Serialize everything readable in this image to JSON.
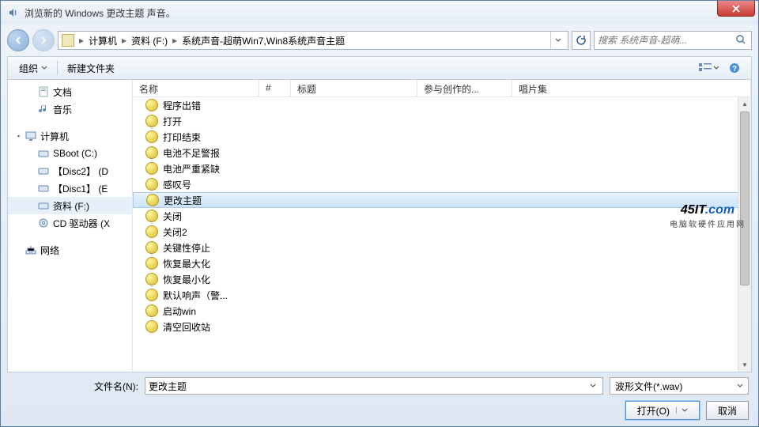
{
  "titlebar": {
    "title": "浏览新的 Windows 更改主题 声音。",
    "close": "X"
  },
  "breadcrumb": {
    "segments": [
      "计算机",
      "资料 (F:)",
      "系统声音-超萌Win7,Win8系统声音主题"
    ],
    "sep": "▸"
  },
  "search": {
    "placeholder": "搜索 系统声音-超萌..."
  },
  "toolbar": {
    "organize": "组织",
    "newfolder": "新建文件夹"
  },
  "tree": {
    "docs": "文档",
    "music": "音乐",
    "computer": "计算机",
    "sboot": "SBoot (C:)",
    "disc2": "【Disc2】 (D",
    "disc1": "【Disc1】 (E",
    "ziliao": "资料 (F:)",
    "cd": "CD 驱动器 (X",
    "network": "网络"
  },
  "columns": {
    "name": "名称",
    "num": "#",
    "title": "标题",
    "artists": "参与创作的...",
    "album": "唱片集"
  },
  "files": [
    "程序出错",
    "打开",
    "打印结束",
    "电池不足警报",
    "电池严重紧缺",
    "感叹号",
    "更改主题",
    "关闭",
    "关闭2",
    "关键性停止",
    "恢复最大化",
    "恢复最小化",
    "默认响声（警...",
    "启动win",
    "清空回收站"
  ],
  "selected_index": 6,
  "watermark": {
    "brand_black": "45IT",
    "brand_blue": ".com",
    "sub": "电脑软硬件应用网"
  },
  "bottom": {
    "filename_label": "文件名(N):",
    "filename_value": "更改主题",
    "filter": "波形文件(*.wav)",
    "open": "打开(O)",
    "cancel": "取消"
  }
}
